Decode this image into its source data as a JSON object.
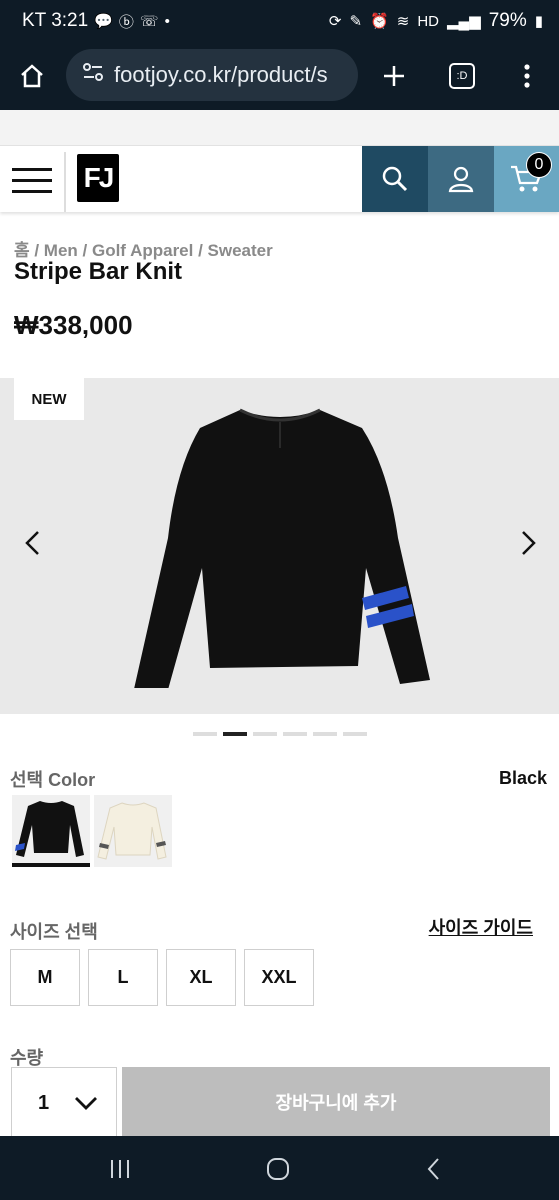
{
  "status_bar": {
    "carrier_time": "KT 3:21",
    "battery": "79%",
    "icons": [
      "talk-icon",
      "b-icon",
      "missed-call-icon",
      "dot-icon",
      "sync-icon",
      "pen-icon",
      "alarm-icon",
      "wifi-icon",
      "hd-icon",
      "signal-icon",
      "battery-icon"
    ]
  },
  "browser": {
    "url": "footjoy.co.kr/product/s",
    "tabs_label": ":D",
    "icons": [
      "home-icon",
      "site-settings-icon",
      "new-tab-icon",
      "tabs-icon",
      "more-icon"
    ]
  },
  "header": {
    "logo": "FJ",
    "cart_count": "0",
    "colors": {
      "search_bg": "#1f4a62",
      "account_bg": "#3d6a82",
      "cart_bg": "#6aa7c2"
    }
  },
  "product": {
    "breadcrumb": "홈 / Men / Golf Apparel / Sweater",
    "title": "Stripe Bar Knit",
    "price": "₩338,000",
    "badge": "NEW",
    "gallery_index": 1,
    "gallery_count": 6
  },
  "options": {
    "color_label": "선택 Color",
    "color_value": "Black",
    "colors": [
      "Black",
      "Cream"
    ],
    "size_label": "사이즈 선택",
    "size_guide": "사이즈 가이드",
    "sizes": [
      "M",
      "L",
      "XL",
      "XXL"
    ],
    "qty_label": "수량",
    "qty_value": "1",
    "add_to_cart": "장바구니에 추가"
  },
  "navbar": {
    "icons": [
      "recents-icon",
      "home-circle-icon",
      "back-icon"
    ]
  }
}
